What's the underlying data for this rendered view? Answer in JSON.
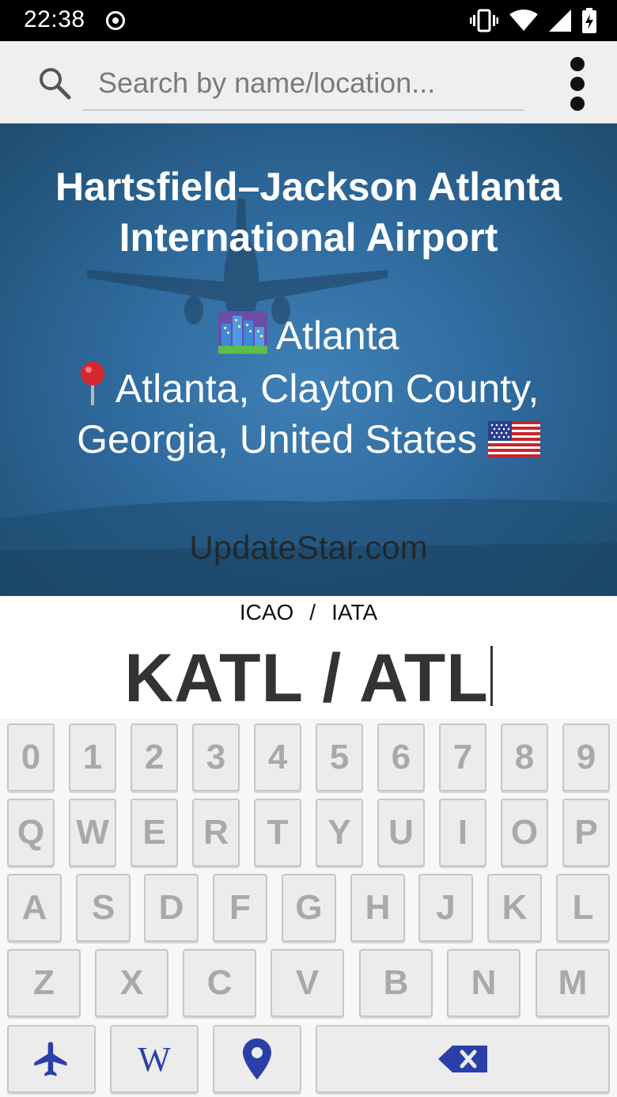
{
  "status_bar": {
    "time": "22:38",
    "icons": [
      "record-icon",
      "vibrate-icon",
      "wifi-icon",
      "signal-icon",
      "battery-charging-icon"
    ]
  },
  "search": {
    "placeholder": "Search by name/location...",
    "value": ""
  },
  "airport": {
    "name_line1": "Hartsfield–Jackson Atlanta",
    "name_line2": "International Airport",
    "city": "Atlanta",
    "location_line1": "Atlanta, Clayton County,",
    "location_line2": "Georgia, United States",
    "watermark": "UpdateStar.com"
  },
  "codes": {
    "label_icao": "ICAO",
    "label_sep": "/",
    "label_iata": "IATA",
    "value": "KATL / ATL"
  },
  "keyboard": {
    "row1": [
      "0",
      "1",
      "2",
      "3",
      "4",
      "5",
      "6",
      "7",
      "8",
      "9"
    ],
    "row2": [
      "Q",
      "W",
      "E",
      "R",
      "T",
      "Y",
      "U",
      "I",
      "O",
      "P"
    ],
    "row3": [
      "A",
      "S",
      "D",
      "F",
      "G",
      "H",
      "J",
      "K",
      "L"
    ],
    "row4": [
      "Z",
      "X",
      "C",
      "V",
      "B",
      "N",
      "M"
    ],
    "function_keys": [
      "airplane-icon",
      "wikipedia-icon",
      "location-pin-icon",
      "backspace-icon"
    ],
    "wiki_label": "W",
    "icon_color": "#2b3fa8"
  },
  "colors": {
    "hero_blue": "#2f6a9d",
    "key_bg": "#ececec",
    "key_text": "#a9a9a9"
  }
}
